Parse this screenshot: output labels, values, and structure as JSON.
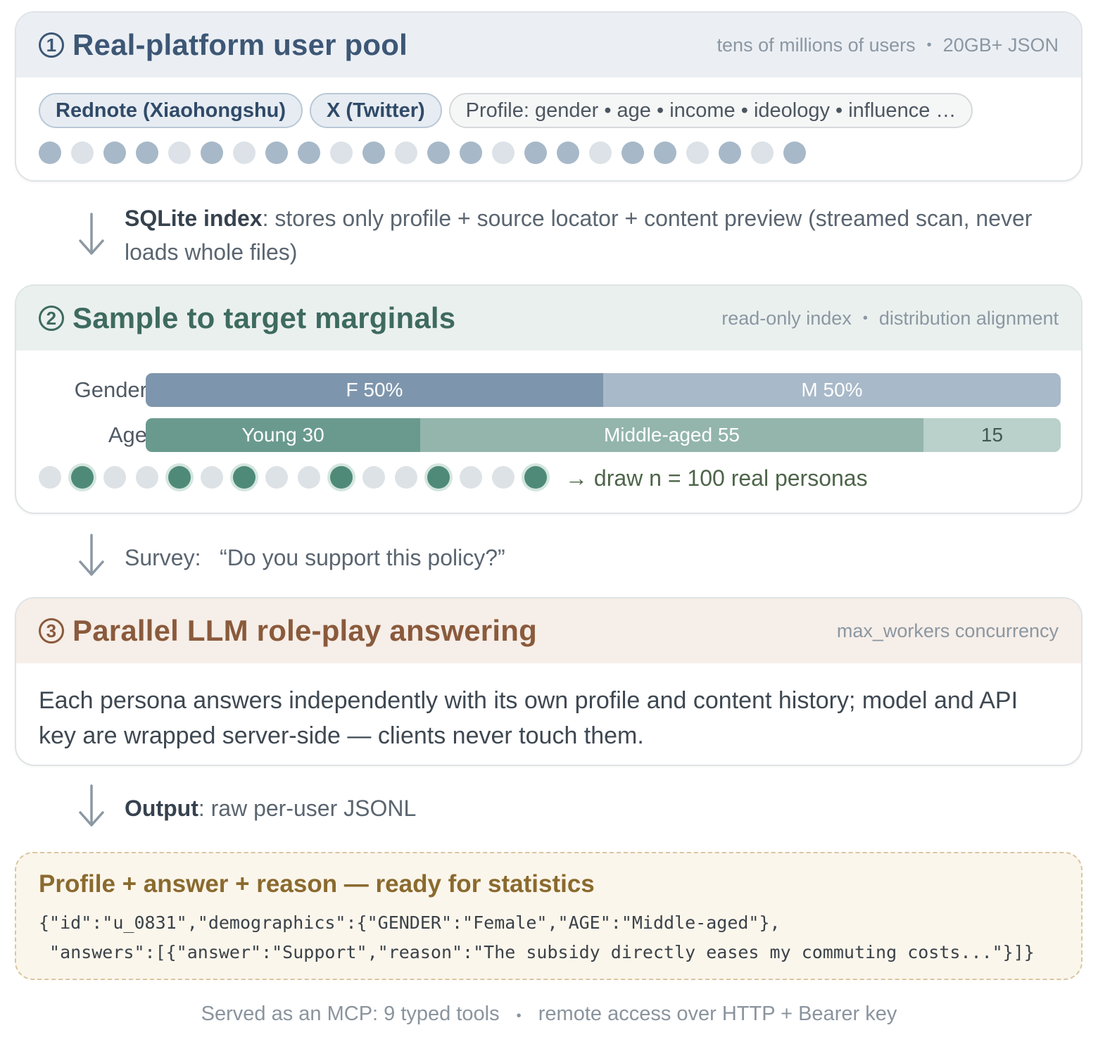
{
  "card1": {
    "number": "1",
    "title": "Real-platform user pool",
    "meta": [
      "tens of millions of users",
      "20GB+ JSON"
    ],
    "platforms": [
      "Rednote (Xiaohongshu)",
      "X (Twitter)"
    ],
    "profile_chip": "Profile: gender • age • income • ideology • influence …",
    "dots": [
      "d",
      "l",
      "d",
      "d",
      "l",
      "d",
      "l",
      "d",
      "d",
      "l",
      "d",
      "l",
      "d",
      "d",
      "l",
      "d",
      "d",
      "l",
      "d",
      "d",
      "l",
      "d",
      "l",
      "d"
    ]
  },
  "arrow1": {
    "bold": "SQLite index",
    "text": ": stores only profile + source locator + content preview (streamed scan, never",
    "text2": "loads whole files)"
  },
  "card2": {
    "number": "2",
    "title": "Sample to target marginals",
    "meta": [
      "read-only index",
      "distribution alignment"
    ],
    "colors": {
      "gender_f": "#7e96ad",
      "gender_m": "#a8b9c9",
      "age_young": "#6a9a8e",
      "age_middle": "#93b5ab",
      "age_old": "#b9d1ca"
    },
    "gender": {
      "label": "Gender",
      "segments": [
        {
          "text": "F 50%",
          "value": 50
        },
        {
          "text": "M 50%",
          "value": 50
        }
      ]
    },
    "age": {
      "label": "Age",
      "segments": [
        {
          "text": "Young 30",
          "value": 30
        },
        {
          "text": "Middle-aged 55",
          "value": 55
        },
        {
          "text": "15",
          "value": 15
        }
      ]
    },
    "sample_dots": [
      "off",
      "on",
      "off",
      "off",
      "on",
      "off",
      "on",
      "off",
      "off",
      "on",
      "off",
      "off",
      "on",
      "off",
      "off",
      "on"
    ],
    "draw_text": "→ draw n = 100 real personas"
  },
  "arrow2": {
    "label": "Survey:",
    "question": "“Do you support this policy?”"
  },
  "card3": {
    "number": "3",
    "title": "Parallel LLM role-play answering",
    "meta": "max_workers concurrency",
    "body": "Each persona answers independently with its own profile and content history; model and API key are wrapped server-side — clients never touch them."
  },
  "arrow3": {
    "bold": "Output",
    "text": ": raw per-user JSONL"
  },
  "output": {
    "title": "Profile + answer + reason — ready for statistics",
    "code_line1": "{\"id\":\"u_0831\",\"demographics\":{\"GENDER\":\"Female\",\"AGE\":\"Middle-aged\"},",
    "code_line2": " \"answers\":[{\"answer\":\"Support\",\"reason\":\"The subsidy directly eases my commuting costs...\"}]}"
  },
  "footer": {
    "left": "Served as an MCP: 9 typed tools",
    "right": "remote access over HTTP + Bearer key"
  }
}
